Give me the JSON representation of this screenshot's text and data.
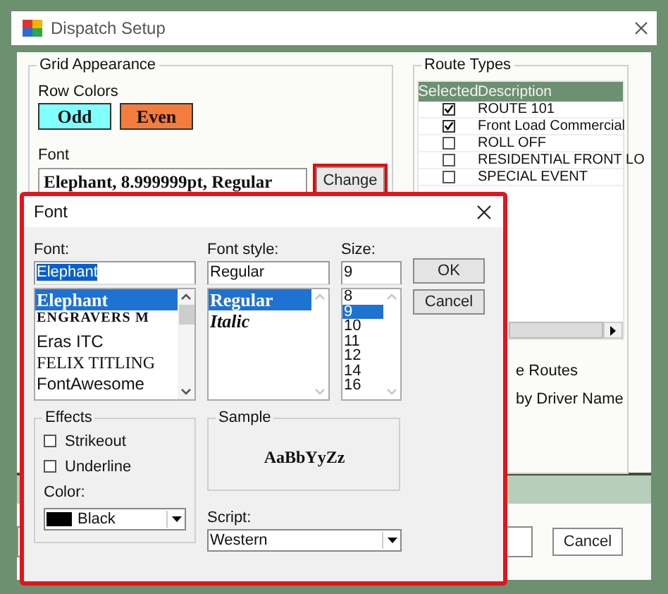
{
  "window": {
    "title": "Dispatch Setup"
  },
  "grid_appearance": {
    "title": "Grid Appearance",
    "row_colors_label": "Row Colors",
    "row_colors": [
      {
        "label": "Odd",
        "color": "#80ffff"
      },
      {
        "label": "Even",
        "color": "#f47c3c"
      }
    ],
    "font_label": "Font",
    "font_value": "Elephant, 8.999999pt, Regular",
    "change_button": "Change"
  },
  "route_types": {
    "title": "Route Types",
    "columns": [
      "Selected",
      "Description"
    ],
    "rows": [
      {
        "description": "ROUTE 101",
        "checked": true
      },
      {
        "description": "Front Load Commercial",
        "checked": true
      },
      {
        "description": "ROLL OFF",
        "checked": false
      },
      {
        "description": "RESIDENTIAL FRONT LO",
        "checked": false
      },
      {
        "description": "SPECIAL EVENT",
        "checked": false
      }
    ]
  },
  "options": [
    "e Routes",
    "by Driver Name"
  ],
  "footer_buttons": [
    "Cancel"
  ],
  "font_dialog": {
    "title": "Font",
    "font": {
      "label": "Font:",
      "value": "Elephant",
      "items": [
        {
          "label": "Elephant",
          "kind": "heavy",
          "selected": true
        },
        {
          "label": "ENGRAVERS M",
          "kind": "engraved",
          "selected": false
        },
        {
          "label": "Eras ITC",
          "kind": "sans",
          "selected": false
        },
        {
          "label": "FELIX TITLING",
          "kind": "titling",
          "selected": false
        },
        {
          "label": "FontAwesome",
          "kind": "sans",
          "selected": false
        }
      ]
    },
    "style": {
      "label": "Font style:",
      "value": "Regular",
      "items": [
        {
          "label": "Regular",
          "kind": "heavy",
          "selected": true
        },
        {
          "label": "Italic",
          "kind": "italic",
          "selected": false
        }
      ]
    },
    "size": {
      "label": "Size:",
      "value": "9",
      "items": [
        {
          "label": "8",
          "selected": false
        },
        {
          "label": "9",
          "selected": true
        },
        {
          "label": "10",
          "selected": false
        },
        {
          "label": "11",
          "selected": false
        },
        {
          "label": "12",
          "selected": false
        },
        {
          "label": "14",
          "selected": false
        },
        {
          "label": "16",
          "selected": false
        }
      ]
    },
    "buttons": [
      "OK",
      "Cancel"
    ],
    "effects": {
      "title": "Effects",
      "options": [
        {
          "label": "Strikeout",
          "checked": false
        },
        {
          "label": "Underline",
          "checked": false
        }
      ],
      "color_label": "Color:",
      "color": {
        "label": "Black",
        "color": "#000000"
      }
    },
    "sample": {
      "title": "Sample",
      "text": "AaBbYyZz"
    },
    "script": {
      "label": "Script:",
      "value": "Western"
    }
  }
}
